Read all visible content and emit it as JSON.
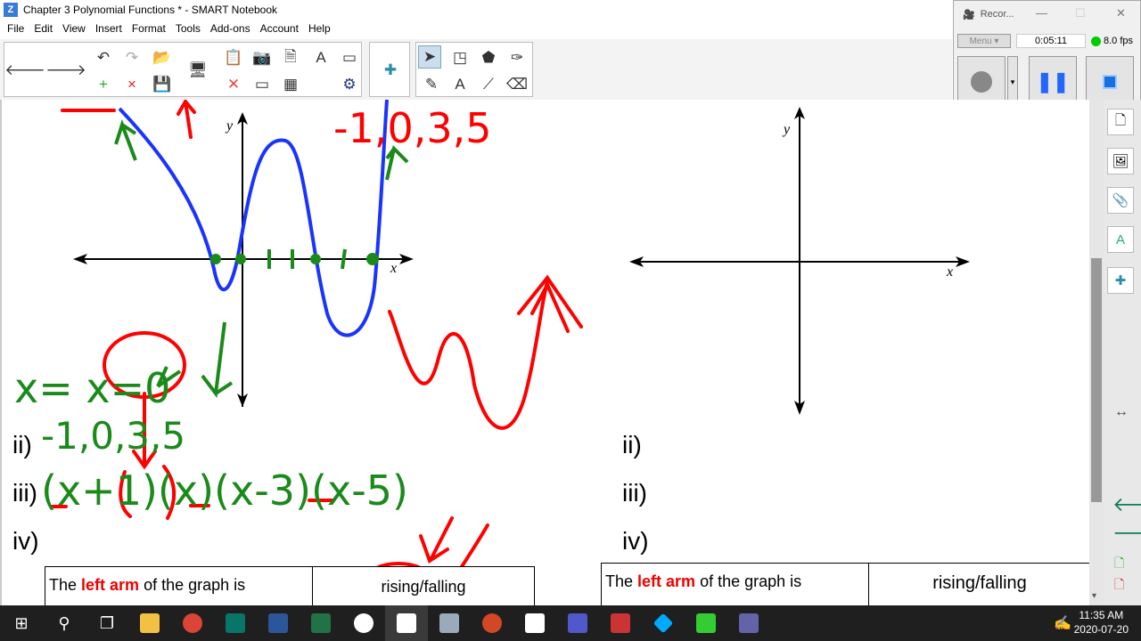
{
  "window": {
    "title": "Chapter 3 Polynomial Functions * - SMART Notebook",
    "logo": "Z"
  },
  "menu": [
    "File",
    "Edit",
    "View",
    "Insert",
    "Format",
    "Tools",
    "Add-ons",
    "Account",
    "Help"
  ],
  "recorder": {
    "title": "Recor...",
    "menu_label": "Menu",
    "time": "0:05:11",
    "fps": "8.0 fps"
  },
  "left_panel": {
    "axis_x": "x",
    "axis_y": "y",
    "label_ii": "ii)",
    "label_iii": "iii)",
    "label_iv": "iv)",
    "table": {
      "prefix": "The ",
      "highlight": "left arm",
      "suffix": " of the graph is",
      "answer": "rising/falling"
    },
    "handwriting": {
      "top_right_zeros": "-1,0,3,5",
      "green_eq": "x= x=0",
      "green_zeros": "-1,0,3,5",
      "factors": "(x+1)(x)(x-3)(x-5)"
    }
  },
  "right_panel": {
    "axis_x": "x",
    "axis_y": "y",
    "label_ii": "ii)",
    "label_iii": "iii)",
    "label_iv": "iv)",
    "table": {
      "prefix": "The ",
      "highlight": "left arm",
      "suffix": " of the graph is",
      "answer": "rising/falling"
    }
  },
  "taskbar": {
    "time": "11:35 AM",
    "date": "2020-07-20"
  },
  "colors": {
    "pen_red": "#ff0000",
    "pen_green": "#1a8a1a",
    "pen_blue": "#1a33ff"
  }
}
